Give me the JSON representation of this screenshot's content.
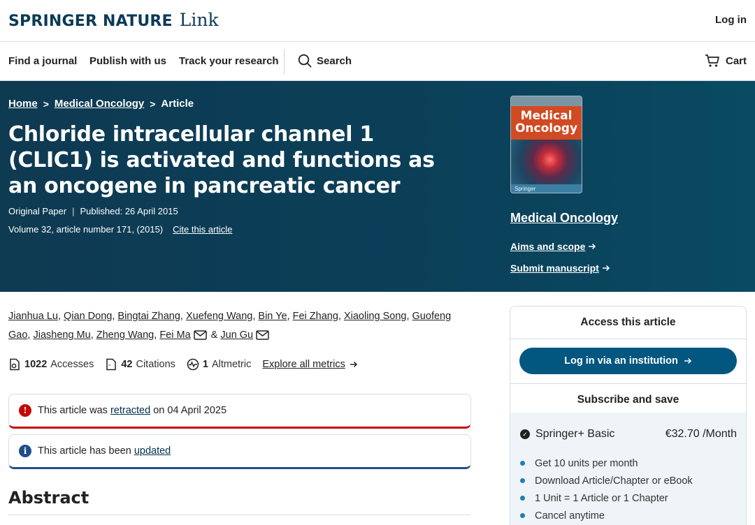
{
  "header": {
    "brand": "SPRINGER NATURE",
    "brand_link": "Link",
    "login": "Log in"
  },
  "nav": {
    "find_journal": "Find a journal",
    "publish": "Publish with us",
    "track": "Track your research",
    "search": "Search",
    "cart": "Cart"
  },
  "breadcrumb": {
    "home": "Home",
    "journal": "Medical Oncology",
    "current": "Article",
    "separator": ">"
  },
  "article": {
    "title": "Chloride intracellular channel 1 (CLIC1) is activated and functions as an oncogene in pancreatic cancer",
    "type": "Original Paper",
    "meta_sep": "|",
    "published": "Published: 26 April 2015",
    "volume": "Volume 32, article number 171, (2015)",
    "cite": "Cite this article"
  },
  "journal": {
    "cover_title_line1": "Medical",
    "cover_title_line2": "Oncology",
    "cover_publisher": "Springer",
    "name": "Medical Oncology",
    "aims": "Aims and scope",
    "submit": "Submit manuscript"
  },
  "authors": {
    "list": [
      "Jianhua Lu",
      "Qian Dong",
      "Bingtai Zhang",
      "Xuefeng Wang",
      "Bin Ye",
      "Fei Zhang",
      "Xiaoling Song",
      "Guofeng Gao",
      "Jiasheng Mu",
      "Zheng Wang",
      "Fei Ma",
      "Jun Gu"
    ],
    "comma": ",",
    "amp": "&"
  },
  "metrics": {
    "accesses_count": "1022",
    "accesses_label": "Accesses",
    "citations_count": "42",
    "citations_label": "Citations",
    "altmetric_count": "1",
    "altmetric_label": "Altmetric",
    "explore": "Explore all metrics"
  },
  "notices": {
    "retracted_pre": "This article was",
    "retracted_link": "retracted",
    "retracted_post": "on 04 April 2025",
    "updated_pre": "This article has been",
    "updated_link": "updated"
  },
  "sections": {
    "abstract": "Abstract"
  },
  "access": {
    "heading": "Access this article",
    "institution_button": "Log in via an institution",
    "subscribe_heading": "Subscribe and save",
    "plan_name": "Springer+ Basic",
    "plan_price": "€32.70 /Month",
    "benefits": [
      "Get 10 units per month",
      "Download Article/Chapter or eBook",
      "1 Unit = 1 Article or 1 Chapter",
      "Cancel anytime"
    ]
  },
  "colors": {
    "brand_navy": "#0b3a57",
    "hero_bg": "#0e3a52",
    "button_blue": "#01577f",
    "retracted_red": "#c40606",
    "updated_blue": "#1d4e89"
  }
}
